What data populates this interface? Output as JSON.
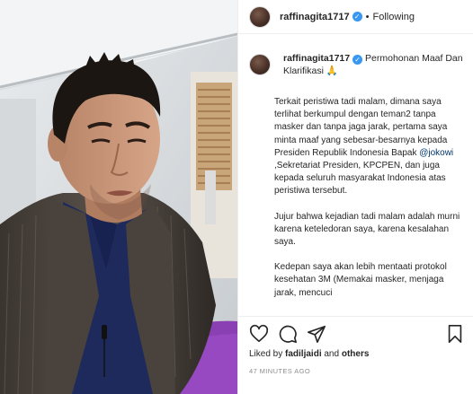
{
  "post": {
    "username": "raffinagita1717",
    "verified_icon": "verified-badge-icon",
    "separator": "•",
    "follow_status": "Following"
  },
  "caption": {
    "username": "raffinagita1717",
    "title": "Permohonan Maaf Dan Klarifikasi 🙏",
    "paragraph1_before": "Terkait peristiwa tadi malam, dimana saya terlihat berkumpul dengan teman2 tanpa masker dan tanpa jaga jarak, pertama saya minta maaf yang sebesar-besarnya kepada Presiden Republik Indonesia Bapak ",
    "mention": "@jokowi",
    "paragraph1_after": " ,Sekretariat Presiden, KPCPEN, dan juga kepada seluruh masyarakat Indonesia atas peristiwa tersebut.",
    "paragraph2": "Jujur bahwa kejadian tadi malam adalah murni karena keteledoran saya, karena kesalahan saya.",
    "paragraph3": "Kedepan saya akan lebih mentaati protokol kesehatan 3M (Memakai masker, menjaga jarak, mencuci"
  },
  "actions": {
    "like_icon": "heart-icon",
    "comment_icon": "comment-icon",
    "share_icon": "send-icon",
    "save_icon": "bookmark-icon",
    "liked_by_prefix": "Liked by ",
    "liked_by_user": "fadiljaidi",
    "liked_by_suffix": " and ",
    "liked_by_others": "others",
    "timestamp": "47 MINUTES AGO"
  },
  "colors": {
    "link": "#00376b",
    "verified": "#3897f0",
    "muted": "#8e8e8e",
    "text": "#262626"
  }
}
